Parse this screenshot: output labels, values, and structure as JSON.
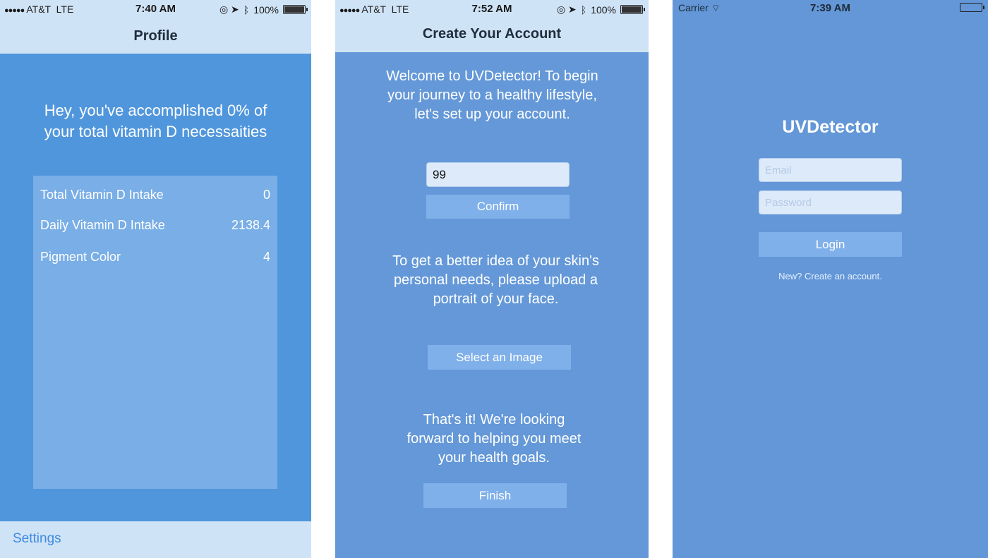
{
  "screens": {
    "profile": {
      "status": {
        "carrier": "AT&T",
        "network": "LTE",
        "time": "7:40 AM",
        "battery": "100%"
      },
      "nav_title": "Profile",
      "message": "Hey, you've accomplished 0% of your total vitamin D necessaities",
      "stats": [
        {
          "label": "Total Vitamin D Intake",
          "value": "0"
        },
        {
          "label": "Daily Vitamin D Intake",
          "value": "2138.4"
        },
        {
          "label": "Pigment Color",
          "value": "4"
        }
      ],
      "tab_label": "Settings"
    },
    "create_account": {
      "status": {
        "carrier": "AT&T",
        "network": "LTE",
        "time": "7:52 AM",
        "battery": "100%"
      },
      "nav_title": "Create Your Account",
      "welcome": "Welcome to UVDetector! To begin your journey to a healthy lifestyle, let's set up your account.",
      "input_value": "99",
      "confirm_label": "Confirm",
      "portrait_text": "To get a better idea of your skin's personal needs, please upload a portrait of your face.",
      "select_image_label": "Select an Image",
      "finish_text": "That's it! We're looking forward to helping you meet your health goals.",
      "finish_label": "Finish"
    },
    "login": {
      "status": {
        "carrier": "Carrier",
        "time": "7:39 AM"
      },
      "app_title": "UVDetector",
      "email_placeholder": "Email",
      "password_placeholder": "Password",
      "login_label": "Login",
      "create_link": "New? Create an account."
    }
  },
  "colors": {
    "profile_bg": "#5096dd",
    "account_bg": "#6498d8",
    "login_bg": "#6397d7",
    "navbar": "#cfe3f6",
    "button": "#7fb0ea",
    "link_blue": "#3f8ae0"
  }
}
